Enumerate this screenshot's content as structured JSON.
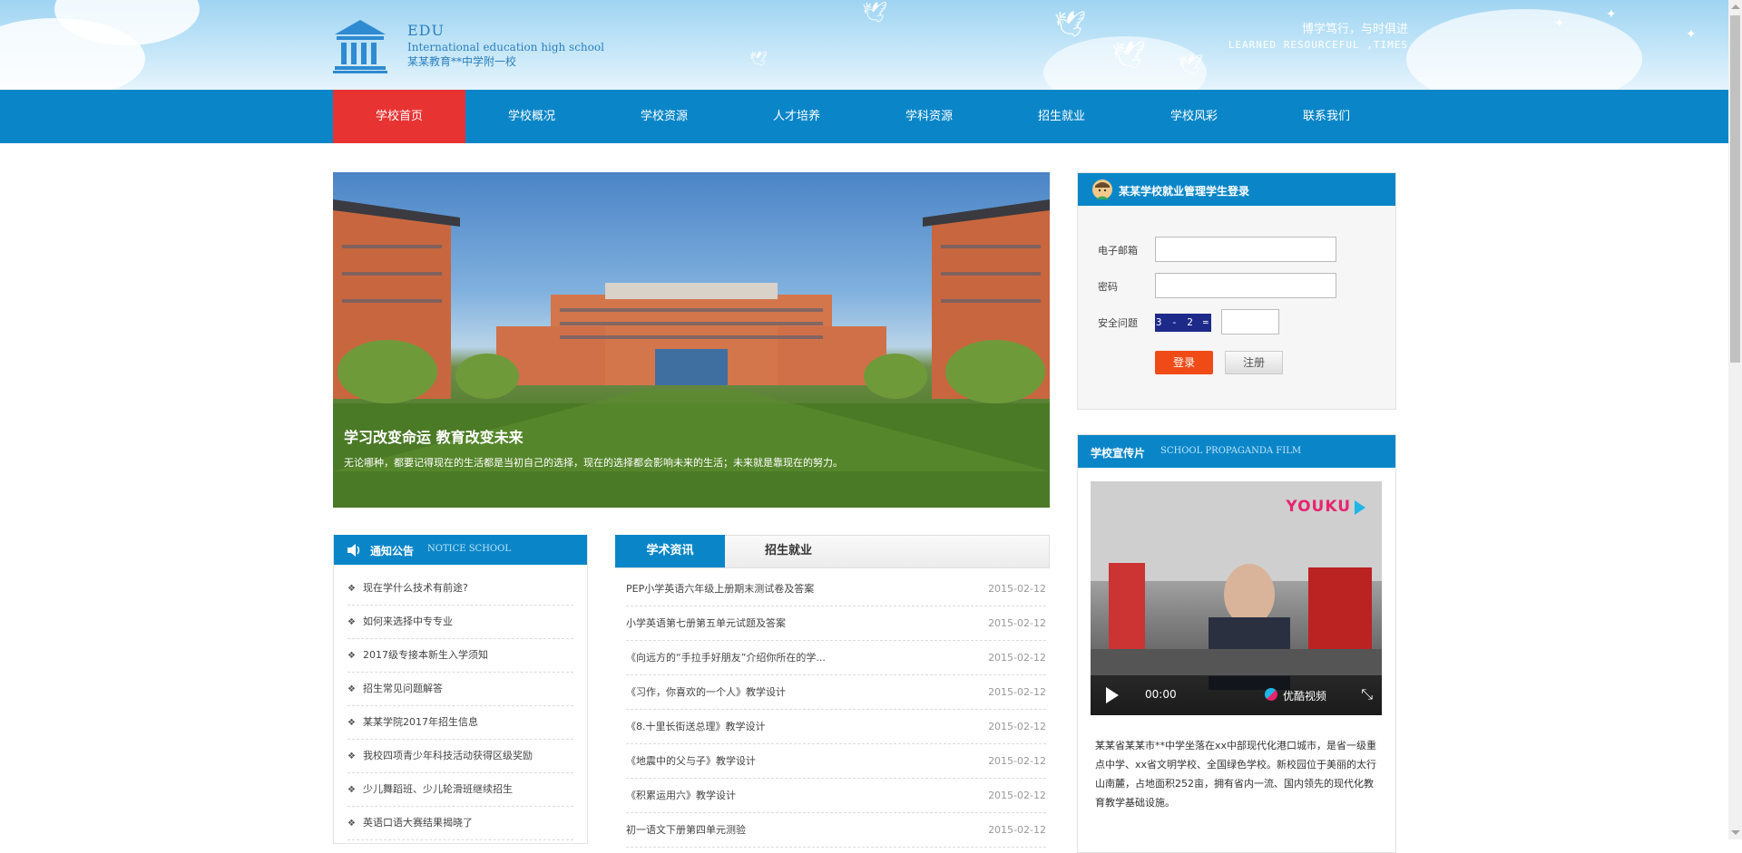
{
  "header": {
    "logo_title": "EDU",
    "logo_subtitle_en": "International education high school",
    "logo_subtitle_cn": "某某教育**中学附一校",
    "slogan_cn": "博学笃行，与时俱进",
    "slogan_en": "LEARNED RESOURCEFUL ,TIMES",
    "logo_icon": "columns-building-icon"
  },
  "nav": {
    "items": [
      {
        "label": "学校首页",
        "active": true
      },
      {
        "label": "学校概况"
      },
      {
        "label": "学校资源"
      },
      {
        "label": "人才培养"
      },
      {
        "label": "学科资源"
      },
      {
        "label": "招生就业"
      },
      {
        "label": "学校风彩"
      },
      {
        "label": "联系我们"
      }
    ]
  },
  "banner": {
    "title": "学习改变命运 教育改变未来",
    "desc": "无论哪种，都要记得现在的生活都是当初自己的选择，现在的选择都会影响未来的生活；未来就是靠现在的努力。"
  },
  "notice": {
    "title": "通知公告",
    "title_en": "NOTICE SCHOOL",
    "icon": "speaker-icon",
    "items": [
      "现在学什么技术有前途?",
      "如何来选择中专专业",
      "2017级专接本新生入学须知",
      "招生常见问题解答",
      "某某学院2017年招生信息",
      "我校四项青少年科技活动获得区级奖励",
      "少儿舞蹈班、少儿轮滑班继续招生",
      "英语口语大赛结果揭晓了"
    ]
  },
  "news": {
    "tabs": [
      "学术资讯",
      "招生就业"
    ],
    "items": [
      {
        "title": "PEP小学英语六年级上册期末测试卷及答案",
        "date": "2015-02-12"
      },
      {
        "title": "小学英语第七册第五单元试题及答案",
        "date": "2015-02-12"
      },
      {
        "title": "《向远方的“手拉手好朋友”介绍你所在的学...",
        "date": "2015-02-12"
      },
      {
        "title": "《习作，你喜欢的一个人》教学设计",
        "date": "2015-02-12"
      },
      {
        "title": "《8.十里长街送总理》教学设计",
        "date": "2015-02-12"
      },
      {
        "title": "《地震中的父与子》教学设计",
        "date": "2015-02-12"
      },
      {
        "title": "《积累运用六》教学设计",
        "date": "2015-02-12"
      },
      {
        "title": "初一语文下册第四单元测验",
        "date": "2015-02-12"
      }
    ]
  },
  "login": {
    "title": "某某学校就业管理学生登录",
    "email_label": "电子邮箱",
    "password_label": "密码",
    "security_label": "安全问题",
    "captcha_text": "3 - 2 =",
    "login_button": "登录",
    "register_button": "注册",
    "icon": "student-avatar-icon"
  },
  "film": {
    "title": "学校宣传片",
    "title_en": "SCHOOL PROPAGANDA FILM",
    "youku_logo": "YOUKU",
    "time": "00:00",
    "brand": "优酷视频",
    "desc": "某某省某某市**中学坐落在xx中部现代化港口城市，是省一级重点中学、xx省文明学校、全国绿色学校。新校园位于美丽的太行山南麓，占地面积252亩，拥有省内一流、国内领先的现代化教育教学基础设施。"
  },
  "colors": {
    "nav_bg": "#0a86c8",
    "nav_active": "#e83333",
    "login_button": "#f04b17"
  }
}
